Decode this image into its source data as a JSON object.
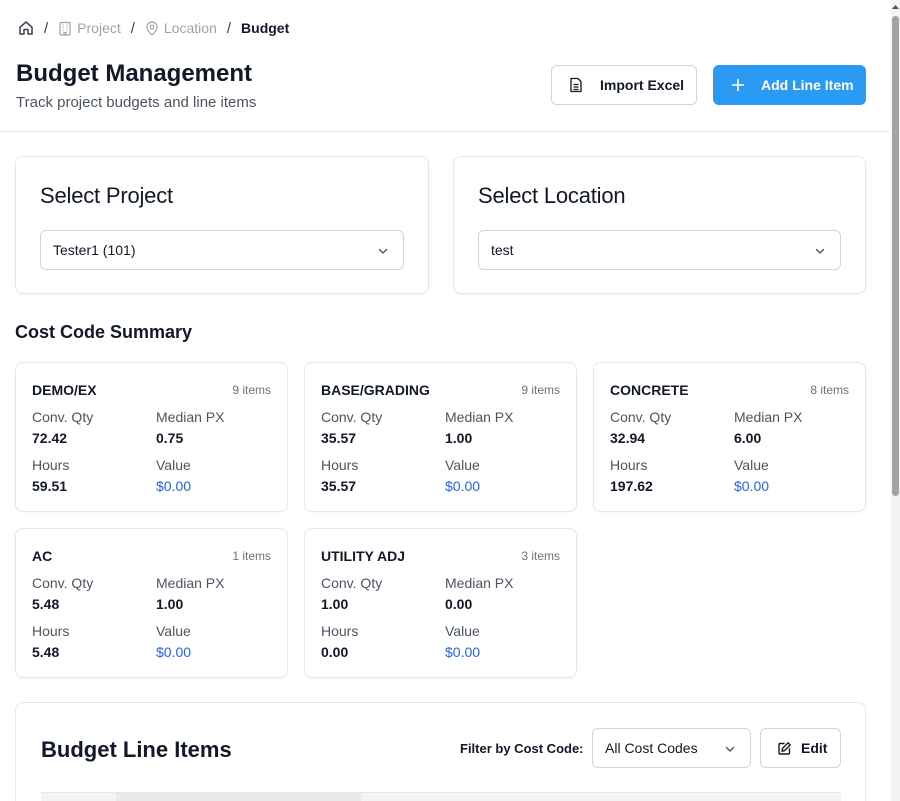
{
  "breadcrumb": {
    "items": [
      {
        "label": "",
        "icon": "home-icon"
      },
      {
        "label": "Project",
        "icon": "building-icon"
      },
      {
        "label": "Location",
        "icon": "map-pin-icon"
      },
      {
        "label": "Budget",
        "icon": ""
      }
    ],
    "separator": "/"
  },
  "header": {
    "title": "Budget Management",
    "subtitle": "Track project budgets and line items",
    "import_label": "Import Excel",
    "add_label": "Add Line Item"
  },
  "colors": {
    "accent": "#2b9af3",
    "money": "#2563eb"
  },
  "project_select": {
    "title": "Select Project",
    "value": "Tester1 (101)"
  },
  "location_select": {
    "title": "Select Location",
    "value": "test"
  },
  "cost_code_summary": {
    "title": "Cost Code Summary",
    "labels": {
      "conv_qty": "Conv. Qty",
      "median_px": "Median PX",
      "hours": "Hours",
      "value": "Value"
    },
    "cards": [
      {
        "name": "DEMO/EX",
        "count": "9 items",
        "conv_qty": "72.42",
        "median_px": "0.75",
        "hours": "59.51",
        "value": "$0.00"
      },
      {
        "name": "BASE/GRADING",
        "count": "9 items",
        "conv_qty": "35.57",
        "median_px": "1.00",
        "hours": "35.57",
        "value": "$0.00"
      },
      {
        "name": "CONCRETE",
        "count": "8 items",
        "conv_qty": "32.94",
        "median_px": "6.00",
        "hours": "197.62",
        "value": "$0.00"
      },
      {
        "name": "AC",
        "count": "1 items",
        "conv_qty": "5.48",
        "median_px": "1.00",
        "hours": "5.48",
        "value": "$0.00"
      },
      {
        "name": "UTILITY ADJ",
        "count": "3 items",
        "conv_qty": "1.00",
        "median_px": "0.00",
        "hours": "0.00",
        "value": "$0.00"
      }
    ]
  },
  "line_items": {
    "title": "Budget Line Items",
    "filter_label": "Filter by Cost Code:",
    "filter_value": "All Cost Codes",
    "edit_label": "Edit"
  }
}
